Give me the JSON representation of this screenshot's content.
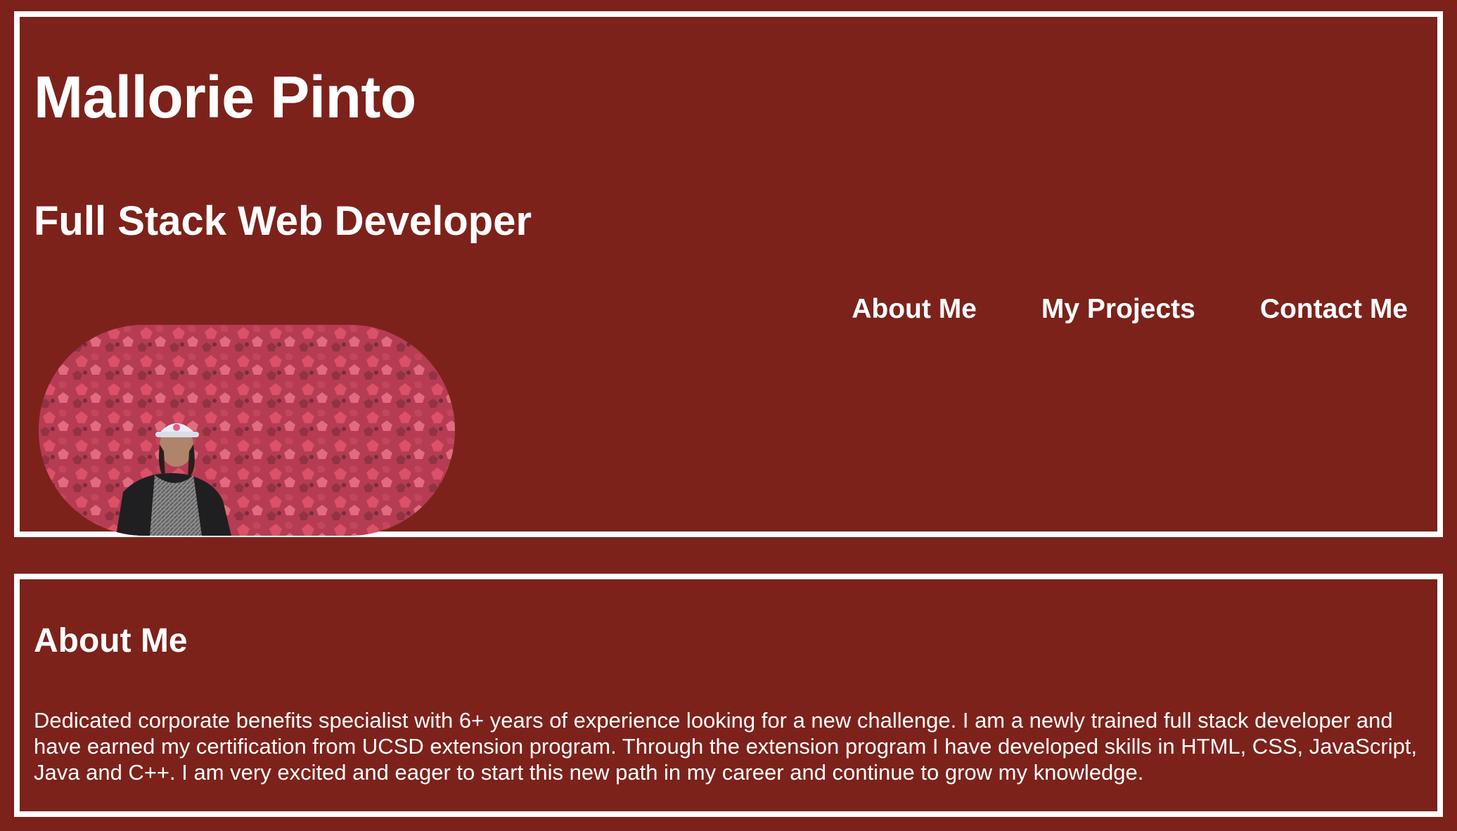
{
  "header": {
    "name": "Mallorie Pinto",
    "role": "Full Stack Web Developer",
    "photo_icon": "profile-photo-ivy-wall"
  },
  "nav": {
    "items": [
      {
        "label": "About Me"
      },
      {
        "label": "My Projects"
      },
      {
        "label": "Contact Me"
      }
    ]
  },
  "about": {
    "title": "About Me",
    "body": "Dedicated corporate benefits specialist with 6+ years of experience looking for a new challenge. I am a newly trained full stack developer and have earned my certification from UCSD extension program. Through the extension program I have developed skills in HTML, CSS, JavaScript, Java and C++. I am very excited and eager to start this new path in my career and continue to grow my knowledge."
  },
  "colors": {
    "background": "#7c221b",
    "border": "#ffffff",
    "text": "#ffffff"
  }
}
